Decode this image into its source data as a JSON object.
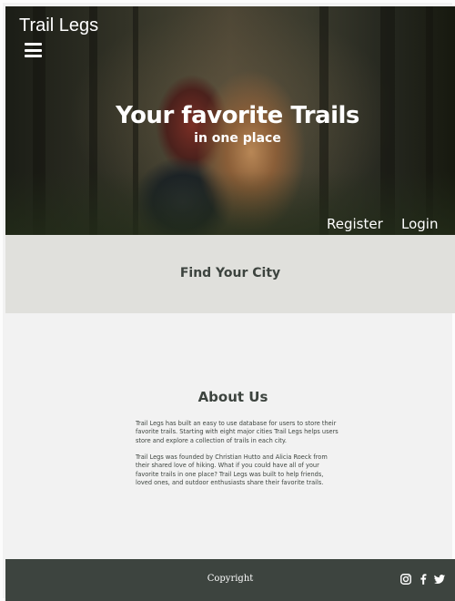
{
  "header": {
    "brand": "Trail Legs",
    "menu_icon": "hamburger-menu-icon"
  },
  "hero": {
    "title": "Your favorite Trails",
    "subtitle": "in one place"
  },
  "nav": {
    "register": "Register",
    "login": "Login"
  },
  "find_city": {
    "title": "Find Your City"
  },
  "about": {
    "title": "About Us",
    "paragraphs": [
      "Trail Legs has built an easy to use database for users to store their favorite trails. Starting with eight major cities Trail Legs helps users store and explore a collection of trails in each city.",
      "Trail Legs was founded by Christian Hutto and Alicia Roeck from their shared love of hiking. What if you could have all of your favorite trails in one place? Trail Legs was built to help friends, loved ones, and outdoor enthusiasts share their favorite trails."
    ]
  },
  "footer": {
    "copyright": "Copyright",
    "social_icons": [
      "instagram-icon",
      "facebook-icon",
      "twitter-icon"
    ]
  },
  "colors": {
    "footer_bg": "#3d443f",
    "band_bg": "#e0e0dc",
    "page_bg": "#f2f2f2",
    "text": "#3d443f"
  }
}
